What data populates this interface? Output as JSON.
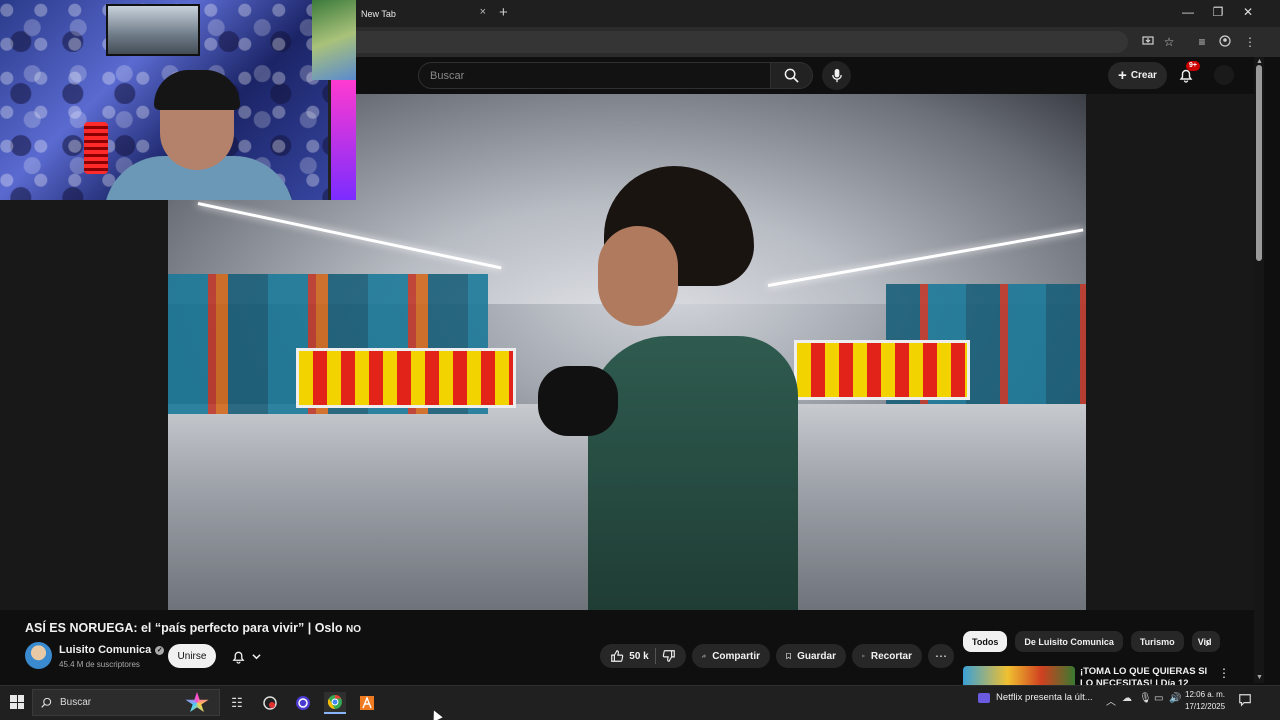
{
  "browser": {
    "tab_title": "New Tab",
    "tab_close": "×",
    "new_tab": "+",
    "window_controls": {
      "minimize": "—",
      "restore": "❐",
      "close": "✕"
    }
  },
  "youtube": {
    "search": {
      "placeholder": "Buscar"
    },
    "create_label": "Crear",
    "notification_badge": "9+",
    "video": {
      "title": "ASÍ ES NORUEGA: el “país perfecto para vivir” | Oslo",
      "title_suffix": "NO"
    },
    "channel": {
      "name": "Luisito Comunica",
      "subscribers": "45.4 M de suscriptores",
      "join_label": "Unirse"
    },
    "actions": {
      "likes": "50 k",
      "share_label": "Compartir",
      "save_label": "Guardar",
      "clip_label": "Recortar",
      "more_label": "⋯"
    },
    "chips": [
      "Todos",
      "De Luisito Comunica",
      "Turismo",
      "Vid"
    ],
    "recommended": {
      "title": "¡TOMA LO QUE QUIERAS SI LO NECESITAS! | Día 12"
    }
  },
  "taskbar": {
    "search_placeholder": "Buscar",
    "notification_text": "Netflix presenta la últ...",
    "clock_time": "12:06 a. m.",
    "clock_date": "17/12/2025"
  },
  "colors": {
    "yt_background": "#0f0f0f",
    "pill_background": "#272727",
    "notification_red": "#cc0000",
    "taskbar": "#202020"
  }
}
